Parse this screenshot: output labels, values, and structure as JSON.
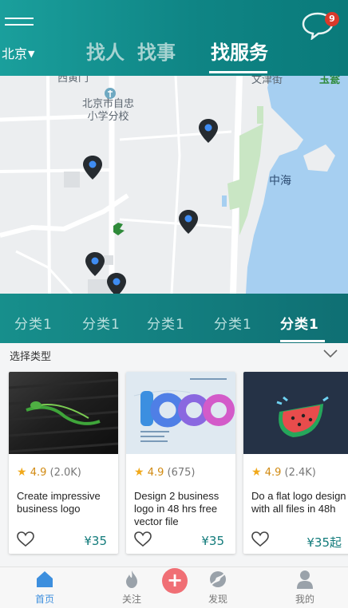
{
  "header": {
    "city": "北京",
    "city_caret": "▼",
    "tabs": [
      {
        "label": "找人",
        "active": false
      },
      {
        "label": "找事",
        "active": false
      },
      {
        "label": "找服务",
        "active": true
      }
    ],
    "message_badge": "9",
    "colors": {
      "bar": "#0f8585",
      "inactive_tab": "#a7d3d1",
      "badge": "#d93a2b"
    }
  },
  "map": {
    "school_line1": "北京市自忠",
    "school_line2": "小学分校",
    "lake": "中海",
    "road_top": "文津街",
    "road_top_right": "玉瓮",
    "road_top_left": "西黄门"
  },
  "categories": {
    "items": [
      {
        "label": "分类1",
        "active": false
      },
      {
        "label": "分类1",
        "active": false
      },
      {
        "label": "分类1",
        "active": false
      },
      {
        "label": "分类1",
        "active": false
      },
      {
        "label": "分类1",
        "active": true
      }
    ]
  },
  "filter": {
    "label": "选择类型",
    "icon": "chevron-down-icon"
  },
  "cards": [
    {
      "rating": "4.9",
      "count": "(2.0K)",
      "title": "Create impressive business logo",
      "price": "¥35",
      "image": "dark-wood-logo-mockup"
    },
    {
      "rating": "4.9",
      "count": "(675)",
      "title": "Design 2 business logo in 48 hrs free vector file",
      "price": "¥35",
      "image": "blue-logo-text-design"
    },
    {
      "rating": "4.9",
      "count": "(2.4K)",
      "title": "Do a flat logo design with all files in 48h",
      "price": "¥35起",
      "image": "flat-watermelon-logo"
    }
  ],
  "bottom_nav": {
    "items": [
      {
        "label": "首页",
        "icon": "home-icon",
        "active": true
      },
      {
        "label": "关注",
        "icon": "flame-icon",
        "active": false
      },
      {
        "label": "发现",
        "icon": "compass-icon",
        "active": false
      },
      {
        "label": "我的",
        "icon": "person-icon",
        "active": false
      }
    ],
    "plus_label": "+",
    "colors": {
      "active": "#3d8fde",
      "plus": "#f06f75"
    }
  }
}
